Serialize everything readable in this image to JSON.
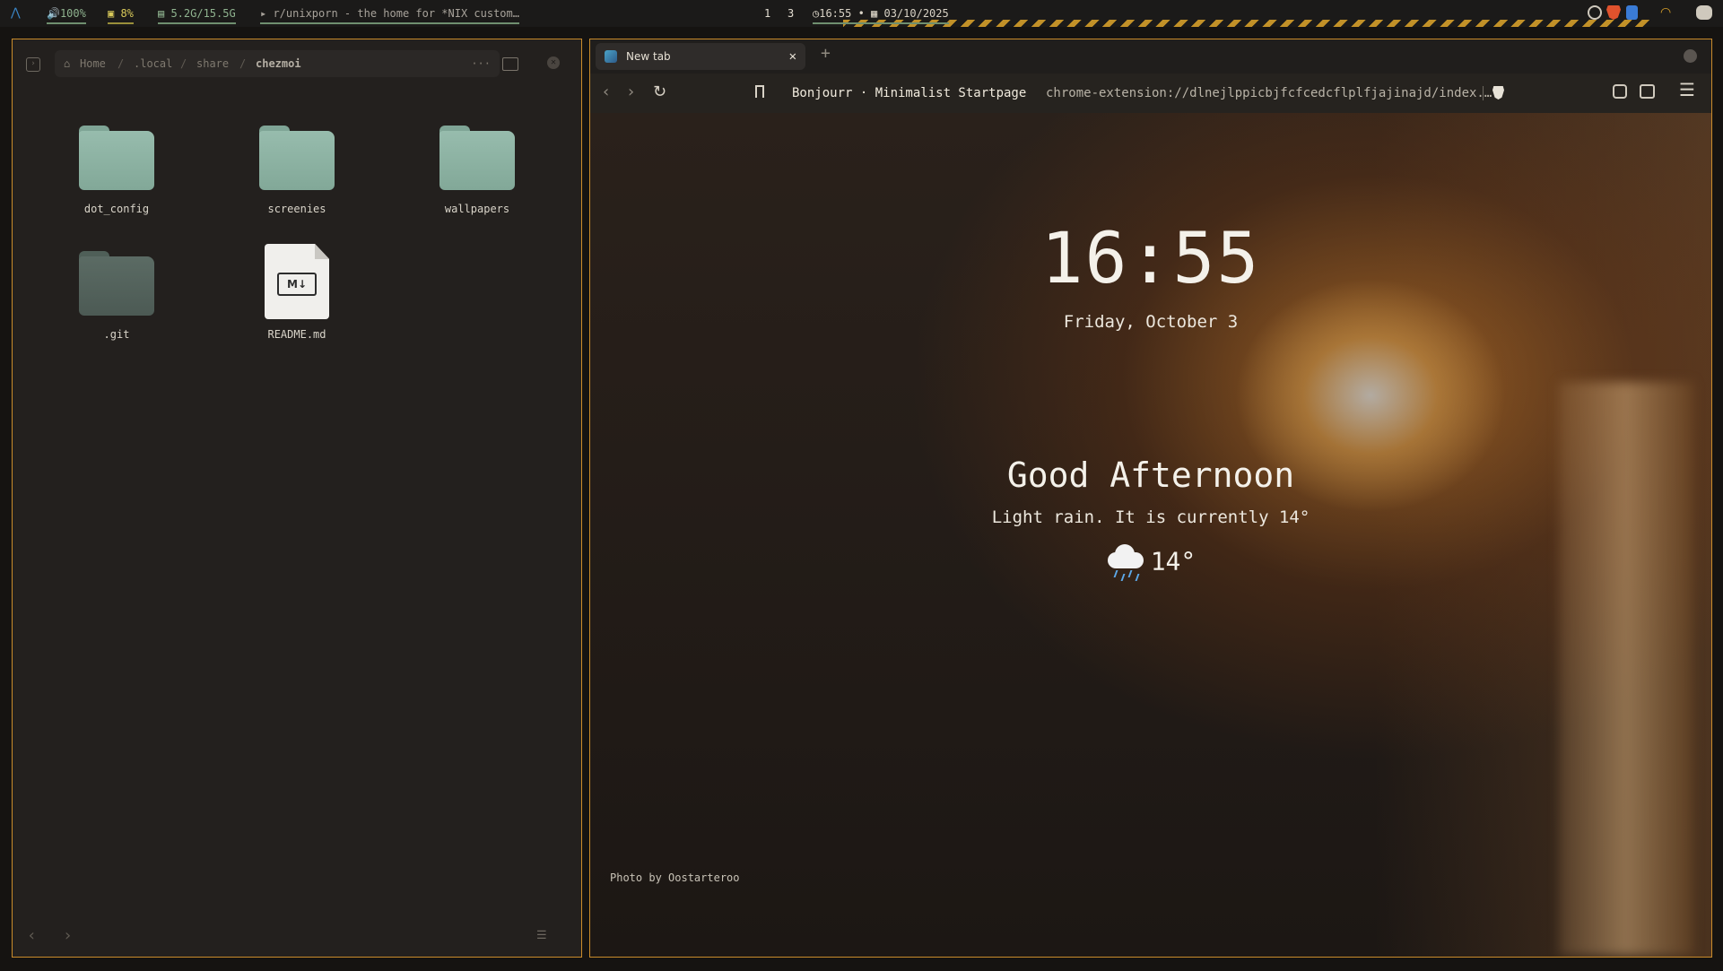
{
  "topbar": {
    "launcher_icon": "arch-logo-icon",
    "volume": "🔊100%",
    "cpu": "▣ 8%",
    "memory": "▤ 5.2G/15.5G",
    "window_title": "▸ r/unixporn - the home for *NIX custom…",
    "workspaces": [
      "1",
      "3"
    ],
    "clock": "◷16:55 • ▦ 03/10/2025",
    "tray_icons": [
      "obs-icon",
      "brave-icon",
      "document-icon",
      "wifi-icon",
      "discord-icon"
    ]
  },
  "file_manager": {
    "breadcrumb": {
      "home_icon": "home-icon",
      "segments": [
        "Home",
        ".local",
        "share",
        "chezmoi"
      ],
      "separator": "/",
      "more": "···"
    },
    "items": [
      {
        "name": "dot_config",
        "type": "folder"
      },
      {
        "name": "screenies",
        "type": "folder"
      },
      {
        "name": "wallpapers",
        "type": "folder"
      },
      {
        "name": ".git",
        "type": "folder"
      },
      {
        "name": "README.md",
        "type": "markdown"
      }
    ],
    "md_badge": "M↓",
    "nav": {
      "back": "‹",
      "forward": "›",
      "view": "☰"
    },
    "close": "✕"
  },
  "browser": {
    "tab": {
      "title": "New tab",
      "close": "✕"
    },
    "new_tab": "+",
    "toolbar": {
      "back": "‹",
      "forward": "›",
      "reload": "↻",
      "site_name": "Bonjourr · Minimalist Startpage",
      "url": "chrome-extension://dlnejlppicbjfcfcedcflplfjajinajd/index.…",
      "menu": "☰"
    },
    "startpage": {
      "time": "16:55",
      "date": "Friday, October 3",
      "greeting": "Good Afternoon",
      "weather_description": "Light rain. It is currently 14°",
      "weather_icon": "rain-cloud-icon",
      "temperature": "14°",
      "photo_credit": "Photo by Oostarteroo"
    }
  },
  "colors": {
    "accent_border": "#c98b2b",
    "folder": "#8fb3a4",
    "bar_green": "#8fb38f"
  }
}
